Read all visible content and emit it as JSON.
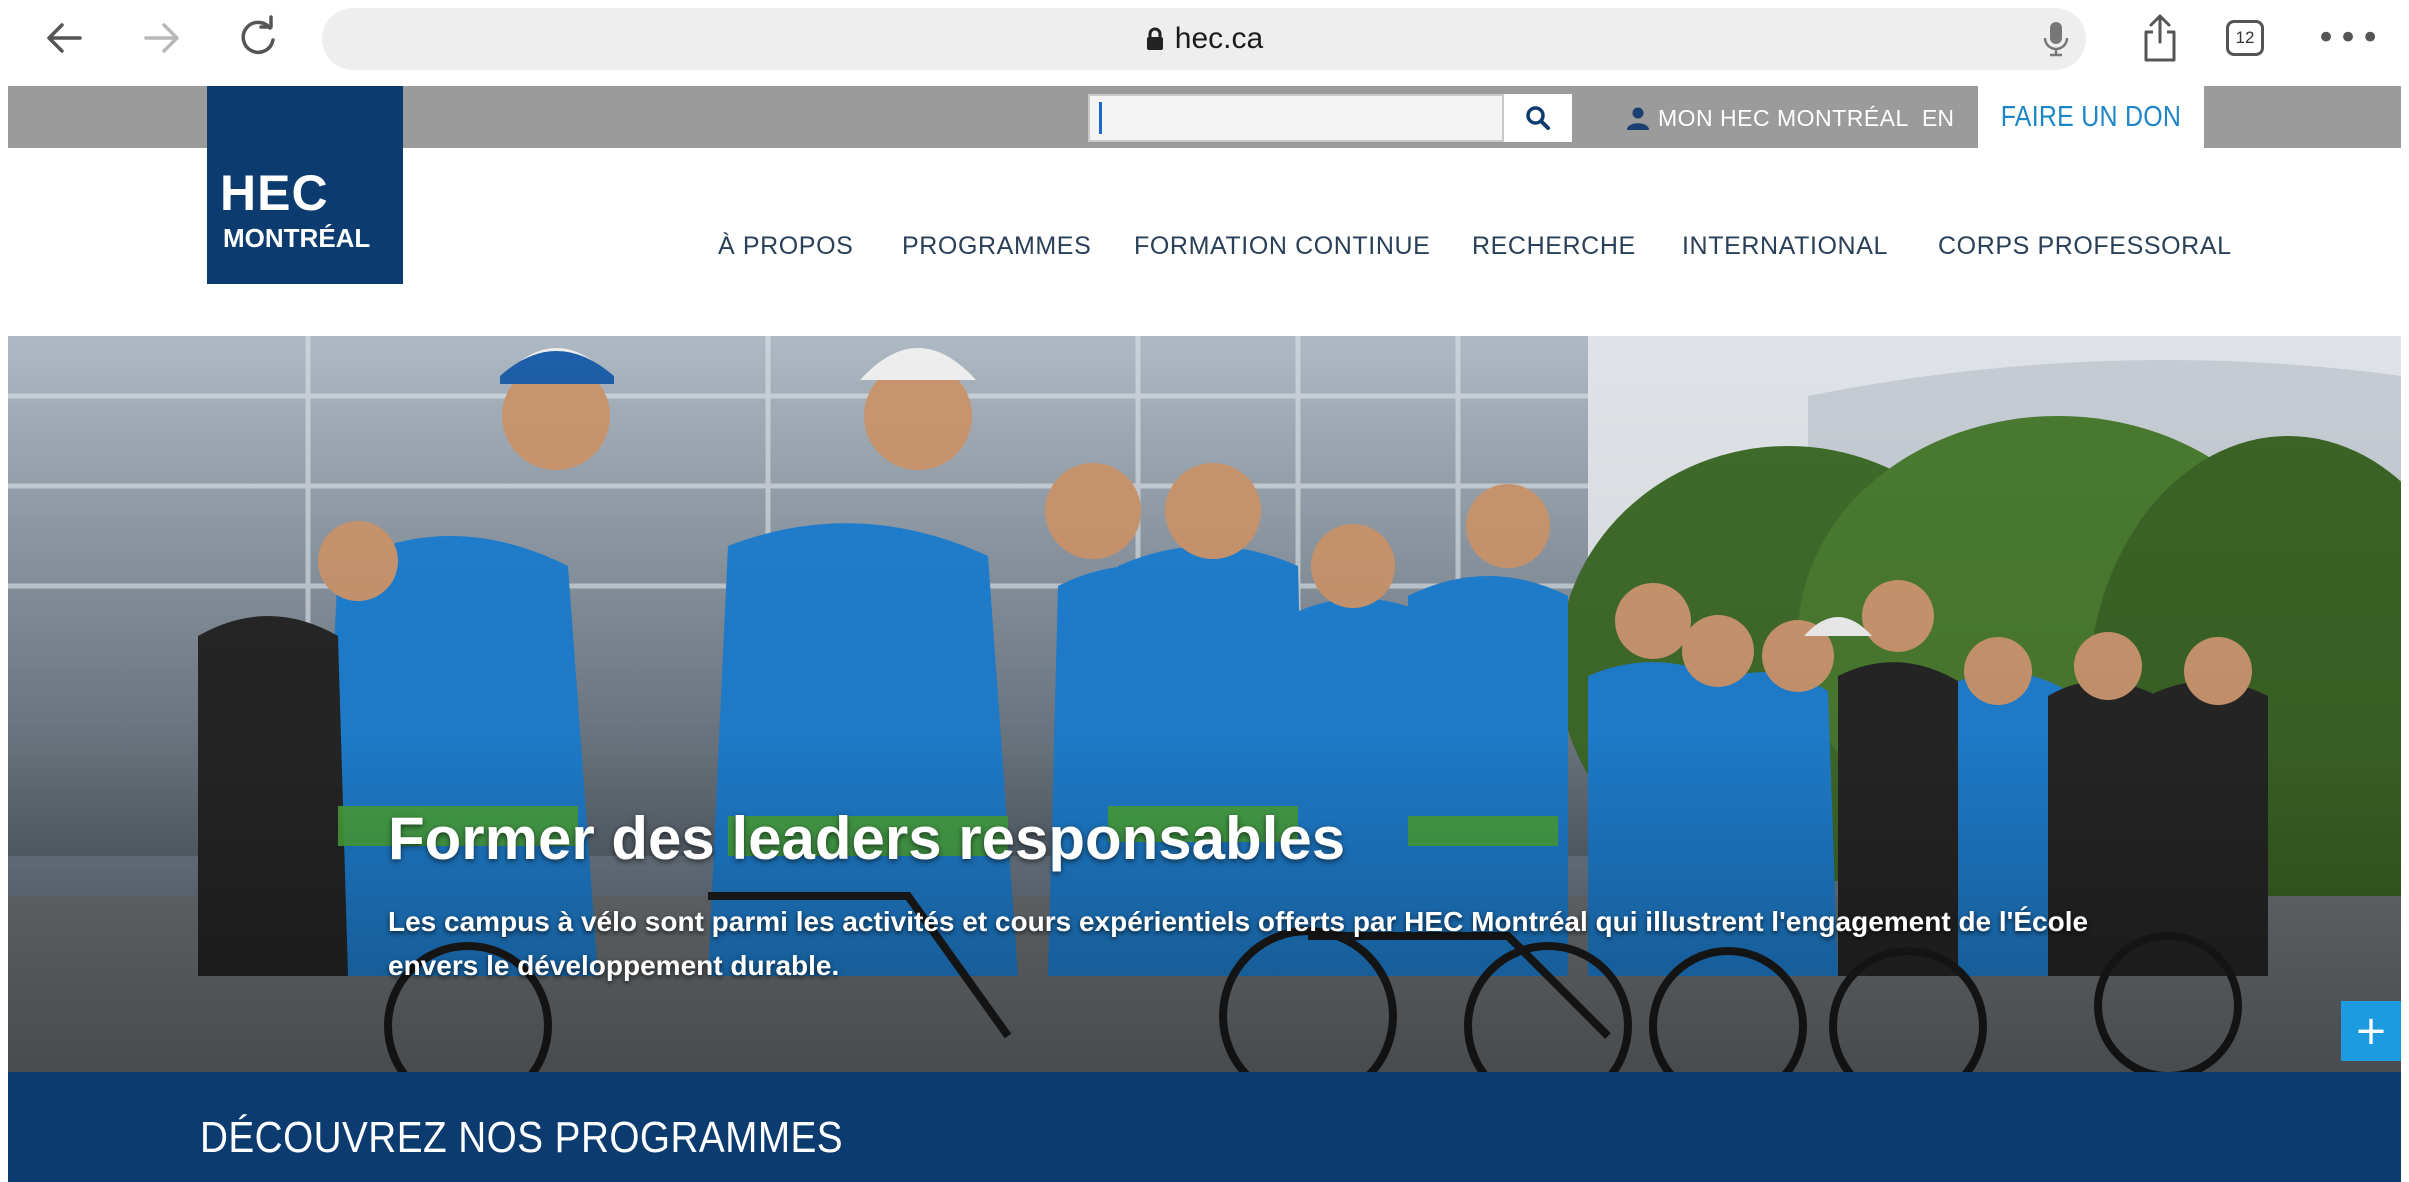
{
  "browser": {
    "url": "hec.ca",
    "tab_count": "12"
  },
  "utility": {
    "search_value": "",
    "mon_hec": "MON HEC MONTRÉAL",
    "lang": "EN",
    "donate": "FAIRE UN DON"
  },
  "logo": {
    "line1": "HEC",
    "line2": "MONTRÉAL"
  },
  "nav": {
    "items": [
      {
        "label": "À PROPOS"
      },
      {
        "label": "PROGRAMMES"
      },
      {
        "label": "FORMATION CONTINUE"
      },
      {
        "label": "RECHERCHE"
      },
      {
        "label": "INTERNATIONAL"
      },
      {
        "label": "CORPS PROFESSORAL"
      }
    ]
  },
  "hero": {
    "title": "Former des leaders responsables",
    "text": "Les campus à vélo sont parmi les activités et cours expérientiels offerts par HEC Montréal qui illustrent l'engagement de l'École envers le développement durable.",
    "plus": "+"
  },
  "band": {
    "title": "DÉCOUVREZ NOS PROGRAMMES"
  },
  "colors": {
    "brand_navy": "#0c3b70",
    "accent_blue": "#1d86c7",
    "utility_gray": "#9b9b9b"
  }
}
